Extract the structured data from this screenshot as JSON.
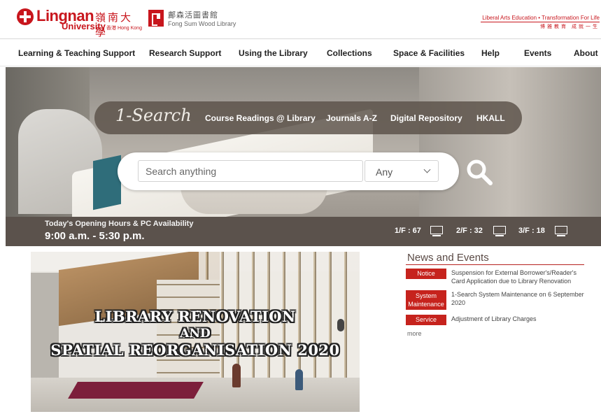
{
  "header": {
    "university": {
      "name": "Lingnan",
      "chinese_name": "嶺南大學",
      "sub": "University",
      "location": "香港 Hong Kong"
    },
    "library": {
      "chinese_name": "鄺森活圖書館",
      "name": "Fong Sum Wood Library"
    },
    "motto": "Liberal Arts Education • Transformation For Life",
    "motto_cn": "博雅教育 成就一生"
  },
  "nav": {
    "items": [
      {
        "label": "Learning & Teaching Support"
      },
      {
        "label": "Research Support"
      },
      {
        "label": "Using the Library"
      },
      {
        "label": "Collections"
      },
      {
        "label": "Space & Facilities"
      },
      {
        "label": "Help"
      },
      {
        "label": "Events"
      },
      {
        "label": "About"
      }
    ]
  },
  "hero": {
    "tabs": {
      "active": "1-Search",
      "links": [
        {
          "label": "Course Readings @ Library"
        },
        {
          "label": "Journals A-Z"
        },
        {
          "label": "Digital Repository"
        },
        {
          "label": "HKALL"
        }
      ]
    },
    "search": {
      "placeholder": "Search anything",
      "value": "",
      "scope_selected": "Any",
      "button_icon": "search-icon"
    }
  },
  "hours": {
    "title": "Today's Opening Hours & PC Availability",
    "time": "9:00 a.m. - 5:30 p.m.",
    "floors": [
      {
        "label": "1/F : 67",
        "icon": "computer-icon"
      },
      {
        "label": "2/F : 32",
        "icon": "computer-icon"
      },
      {
        "label": "3/F : 18",
        "icon": "computer-icon"
      }
    ]
  },
  "banner": {
    "line1": "Library Renovation",
    "line2": "and",
    "line3": "Spatial Reorganisation 2020"
  },
  "news": {
    "title": "News and Events",
    "items": [
      {
        "tag": "Notice",
        "text": "Suspension for External Borrower's/Reader's Card Application due to Library Renovation"
      },
      {
        "tag": "System Maintenance",
        "text": "1-Search System Maintenance on 6 September 2020"
      },
      {
        "tag": "Service",
        "text": "Adjustment of Library Charges"
      }
    ],
    "more": "more"
  },
  "colors": {
    "brand_red": "#c8161d",
    "strip_brown": "#5b524c",
    "tag_red": "#c6231d"
  }
}
